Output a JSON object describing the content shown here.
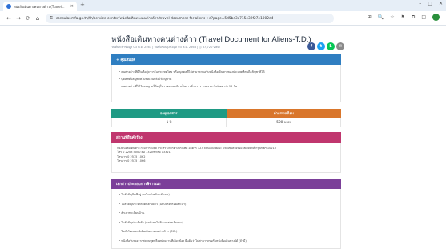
{
  "browser": {
    "tab_title": "หนังสือเดินทางคนต่างด้าว (Travel...",
    "tab_close": "×",
    "new_tab": "+",
    "url": "consular.mfa.go.th/th/service-center/หนังสือเดินทางคนต่างด้าว-travel-document-for-aliens-t-d?page=5d5bd3c715e39f27e1002d4",
    "win_minimize": "–",
    "win_maximize": "□",
    "win_close": "✕",
    "back": "←",
    "forward": "→",
    "reload": "⟳",
    "home": "⌂",
    "lock": "⚿",
    "ext_icons": [
      "⊞",
      "🔍",
      "☆",
      "⚑",
      "⧉",
      "□"
    ]
  },
  "page": {
    "title": "หนังสือเดินทางคนต่างด้าว (Travel Document for Aliens-T.D.)",
    "meta": "วันที่นำเข้าข้อมูล 03 พ.ย. 2563  |  วันที่ปรับปรุงข้อมูล 03 พ.ย. 2563  |  ◎ 37,720 view",
    "share": {
      "facebook": "f",
      "twitter": "t",
      "line": "L",
      "email": "✉"
    }
  },
  "qualification": {
    "header": "+ คุณสมบัติ",
    "bullets": [
      "• คนต่างด้าวที่มีถิ่นที่อยู่ถาวรในประเทศไทย หรือ บุคคลที่ไม่สามารถขอรับหนังสือเดินทางของประเทศที่ตนถือสัญชาติได้",
      "• บุคคลที่มีสัญชาติไม่ชัดเจนหรือไร้สัญชาติ",
      "• คนต่างด้าวที่ได้รับอนุญาตให้อยู่ในราชอาณาจักรเป็นการชั่วคราว ระยะเวลาไม่น้อยกว่า 90 วัน"
    ]
  },
  "duration_table": {
    "headers": [
      "อายุเอกสาร",
      "ค่าธรรมเนียม"
    ],
    "rows": [
      [
        "1 ปี",
        "500 บาท"
      ]
    ]
  },
  "place": {
    "header": "สถานที่ยื่นคำร้อง",
    "lines": [
      "กองหนังสือเดินทาง กรมการกงสุล กระทรวงการต่างประเทศ อาคาร 123 ถนนแจ้งวัฒนะ แขวงทุ่งสองห้อง เขตหลักสี่ กรุงเทพฯ 10210",
      "โทร 0 2203 5000 ต่อ 13209 หรือ 13321",
      "โทรสาร 0 2575 1062",
      "โทรสาร 0 2575 1066"
    ]
  },
  "documents": {
    "header": "เอกสารประกอบการพิจารณา",
    "items": [
      "• ใบสำคัญถิ่นที่อยู่ (ฉบับจริงพร้อมสำเนา)",
      "• ใบสำคัญประจำตัวคนต่างด้าว (ฉบับจริงพร้อมสำเนา)",
      "• สำเนาทะเบียนบ้าน",
      "• ใบสำคัญประจำตัว (กรณีเคยได้รับเอกสารเดินทาง)",
      "• ใบคำร้องขอหนังสือเดินทางคนต่างด้าว (T.D.)",
      "• หนังสือรับรองจากสถานทูตหรือหน่วยงานที่เกี่ยวข้อง ยืนยันว่าไม่สามารถขอรับหนังสือเดินทางได้ (ถ้ามี)"
    ]
  }
}
